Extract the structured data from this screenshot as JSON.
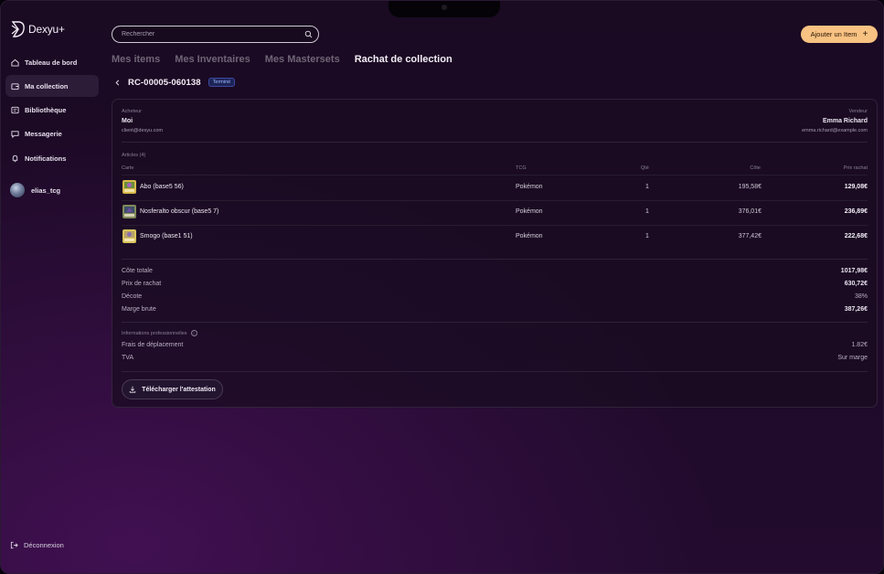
{
  "app": {
    "name": "Dexyu+"
  },
  "sidebar": {
    "items": [
      {
        "label": "Tableau de bord",
        "icon": "home-icon"
      },
      {
        "label": "Ma collection",
        "icon": "wallet-icon"
      },
      {
        "label": "Bibliothèque",
        "icon": "library-icon"
      },
      {
        "label": "Messagerie",
        "icon": "chat-icon"
      },
      {
        "label": "Notifications",
        "icon": "bell-icon"
      }
    ],
    "user": {
      "name": "elias_tcg"
    },
    "logout_label": "Déconnexion"
  },
  "header": {
    "search_placeholder": "Rechercher",
    "add_button_label": "Ajouter un Item",
    "add_button_icon": "+"
  },
  "tabs": [
    {
      "label": "Mes items"
    },
    {
      "label": "Mes Inventaires"
    },
    {
      "label": "Mes Mastersets"
    },
    {
      "label": "Rachat de collection"
    }
  ],
  "order": {
    "id": "RC-00005-060138",
    "status": "Terminé"
  },
  "parties": {
    "buyer_label": "Acheteur",
    "buyer_name": "Moi",
    "buyer_email": "client@dexyu.com",
    "seller_label": "Vendeur",
    "seller_name": "Emma Richard",
    "seller_email": "emma.richard@example.com"
  },
  "articles": {
    "title": "Articles (4)",
    "columns": [
      "Carte",
      "TCG",
      "Qté",
      "Côte",
      "Prix rachat"
    ],
    "rows": [
      {
        "name": "Abo (base5 56)",
        "tcg": "Pokémon",
        "qty": "1",
        "cote": "195,58€",
        "prix": "129,08€"
      },
      {
        "name": "Nosferalto obscur (base5 7)",
        "tcg": "Pokémon",
        "qty": "1",
        "cote": "376,01€",
        "prix": "236,89€"
      },
      {
        "name": "Smogo (base1 51)",
        "tcg": "Pokémon",
        "qty": "1",
        "cote": "377,42€",
        "prix": "222,68€"
      }
    ]
  },
  "summary": {
    "cote_totale_label": "Côte totale",
    "cote_totale": "1017,98€",
    "prix_rachat_label": "Prix de rachat",
    "prix_rachat": "630,72€",
    "decote_label": "Décote",
    "decote": "38%",
    "marge_label": "Marge brute",
    "marge": "387,26€"
  },
  "pro": {
    "title": "Informations professionnelles",
    "frais_label": "Frais de déplacement",
    "frais": "1.82€",
    "tva_label": "TVA",
    "tva": "Sur marge"
  },
  "download_label": "Télécharger l'attestation",
  "colors": {
    "accent_button": "#f7c282",
    "badge": "#9fb6ff"
  }
}
